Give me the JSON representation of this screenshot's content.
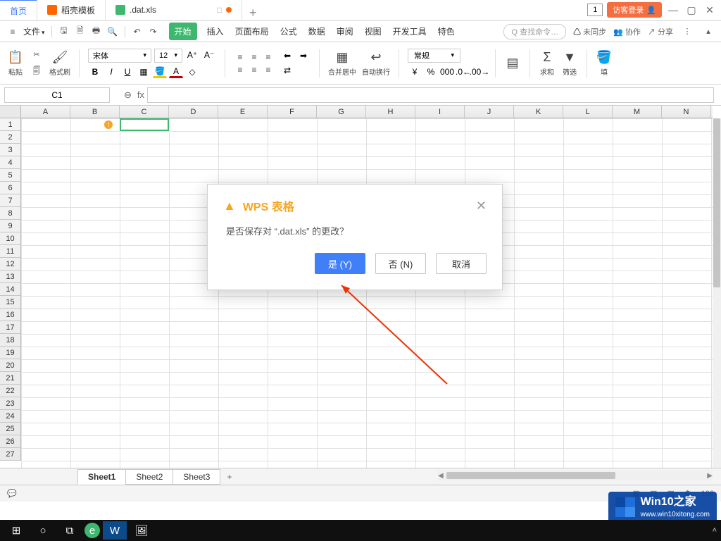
{
  "title_tabs": {
    "home": "首页",
    "template": "稻壳模板",
    "file": ".dat.xls",
    "add": "+",
    "badge": "1",
    "login": "访客登录"
  },
  "menubar": {
    "file": "文件",
    "tabs": [
      "开始",
      "插入",
      "页面布局",
      "公式",
      "数据",
      "审阅",
      "视图",
      "开发工具",
      "特色"
    ],
    "search": "Q 查找命令…",
    "right": [
      "未同步",
      "协作",
      "分享"
    ]
  },
  "ribbon": {
    "paste": "粘贴",
    "brush": "格式刷",
    "font": "宋体",
    "size": "12",
    "merge": "合并居中",
    "wrap": "自动换行",
    "fmt": "常规",
    "sum": "求和",
    "filter": "筛选",
    "fill": "填"
  },
  "cellbar": {
    "name": "C1",
    "fx": "fx"
  },
  "cols": [
    "A",
    "B",
    "C",
    "D",
    "E",
    "F",
    "G",
    "H",
    "I",
    "J",
    "K",
    "L",
    "M",
    "N"
  ],
  "rows": [
    "1",
    "2",
    "3",
    "4",
    "5",
    "6",
    "7",
    "8",
    "9",
    "10",
    "11",
    "12",
    "13",
    "14",
    "15",
    "16",
    "17",
    "18",
    "19",
    "20",
    "21",
    "22",
    "23",
    "24",
    "25",
    "26",
    "27"
  ],
  "dialog": {
    "title": "WPS 表格",
    "msg": "是否保存对 “.dat.xls” 的更改？",
    "yes": "是 (Y)",
    "no": "否 (N)",
    "cancel": "取消"
  },
  "sheets": {
    "s1": "Sheet1",
    "s2": "Sheet2",
    "s3": "Sheet3",
    "add": "+"
  },
  "status": {
    "zoom": "100"
  },
  "watermark": {
    "line1": "Win10之家",
    "line2": "www.win10xitong.com"
  }
}
